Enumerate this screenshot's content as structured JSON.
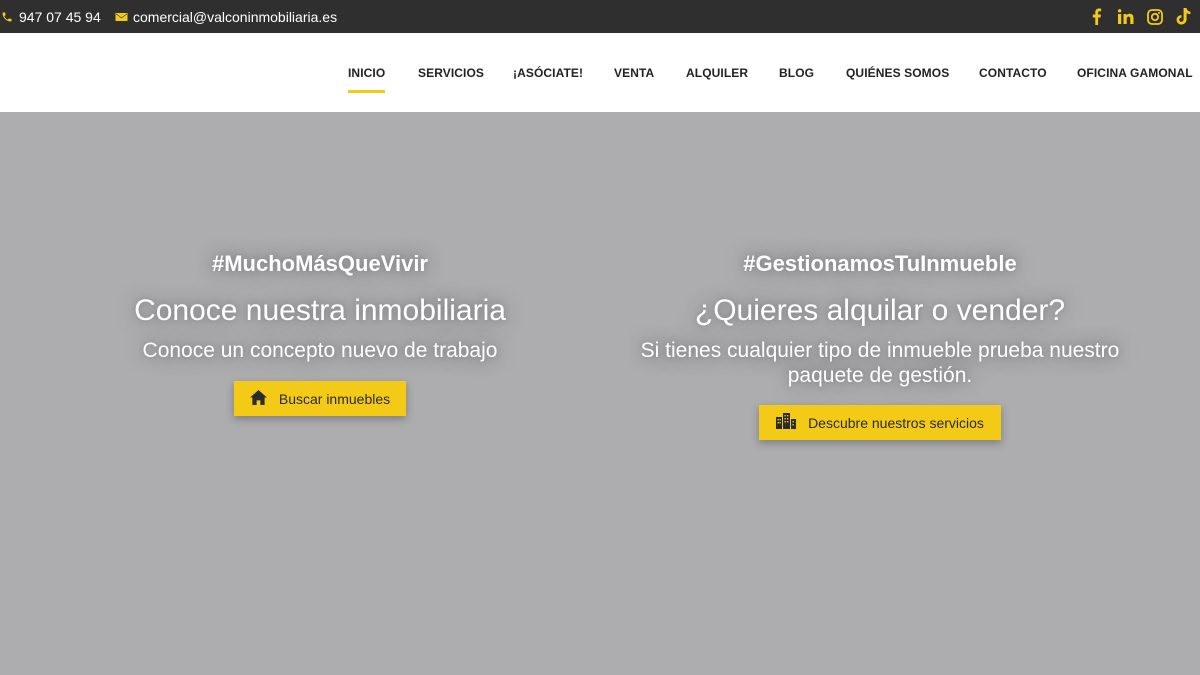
{
  "topbar": {
    "phone": "947 07 45 94",
    "email": "comercial@valconinmobiliaria.es",
    "phone_icon": "phone-icon",
    "email_icon": "envelope-icon",
    "socials": [
      "facebook-icon",
      "linkedin-icon",
      "instagram-icon",
      "tiktok-icon"
    ]
  },
  "nav": {
    "items": [
      {
        "label": "INICIO",
        "active": true
      },
      {
        "label": "SERVICIOS"
      },
      {
        "label": "¡ASÓCIATE!"
      },
      {
        "label": "VENTA"
      },
      {
        "label": "ALQUILER"
      },
      {
        "label": "BLOG"
      },
      {
        "label": "QUIÉNES SOMOS"
      },
      {
        "label": "CONTACTO"
      },
      {
        "label": "OFICINA GAMONAL"
      }
    ]
  },
  "hero": {
    "left": {
      "tag": "#MuchoMásQueVivir",
      "heading": "Conoce nuestra inmobiliaria",
      "sub": "Conoce un concepto nuevo de trabajo",
      "button": "Buscar inmuebles",
      "button_icon": "home-icon"
    },
    "right": {
      "tag": "#GestionamosTuInmueble",
      "heading": "¿Quieres alquilar o vender?",
      "sub_line1": "Si tienes cualquier tipo de inmueble prueba nuestro",
      "sub_line2": "paquete de gestión.",
      "button": "Descubre nuestros servicios",
      "button_icon": "buildings-icon"
    }
  },
  "colors": {
    "accent": "#f3cb17",
    "topbar_bg": "#2f2f2f",
    "hero_bg": "#adadaf",
    "nav_bg": "#ffffff"
  }
}
